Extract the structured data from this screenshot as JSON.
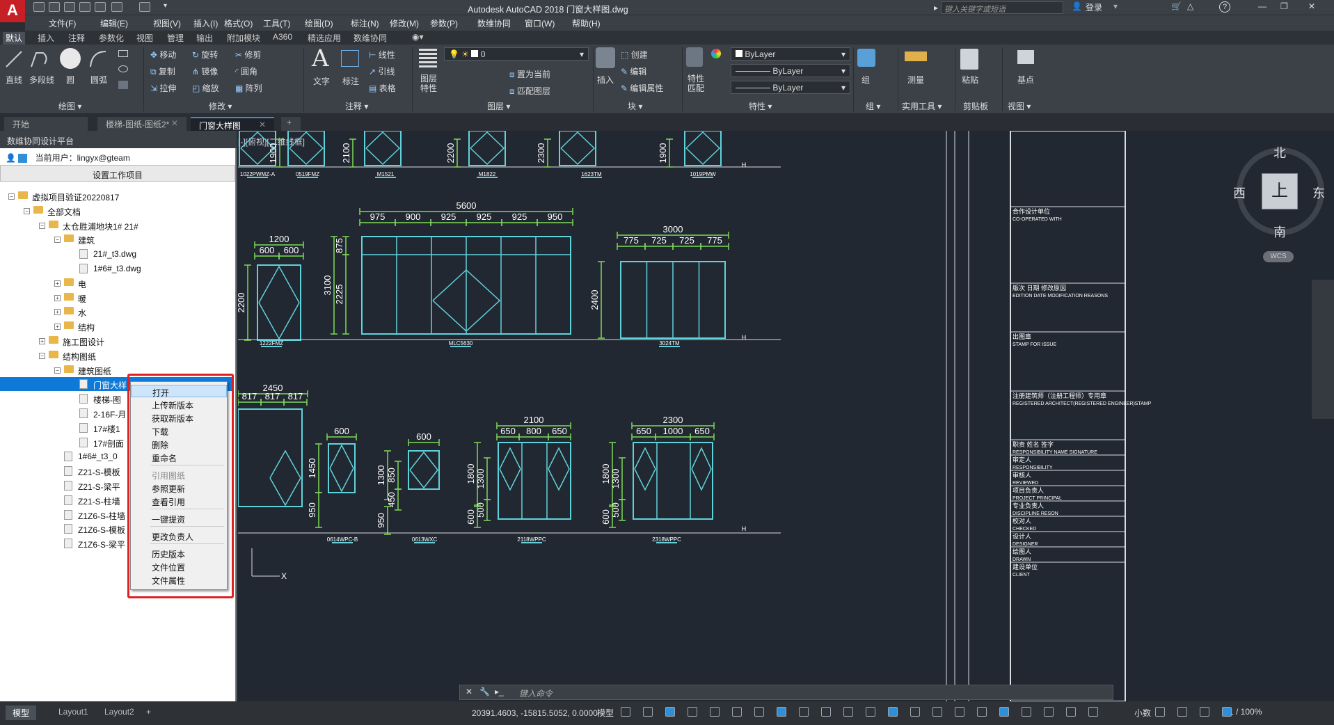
{
  "app": {
    "title": "Autodesk AutoCAD 2018    门窗大样图.dwg",
    "logo": "A",
    "search_placeholder": "键入关键字或短语",
    "login": "登录"
  },
  "menu": [
    "文件(F)",
    "编辑(E)",
    "视图(V)",
    "插入(I)",
    "格式(O)",
    "工具(T)",
    "绘图(D)",
    "标注(N)",
    "修改(M)",
    "参数(P)",
    "数维协同",
    "窗口(W)",
    "帮助(H)"
  ],
  "ribbon_tabs": [
    "默认",
    "插入",
    "注释",
    "参数化",
    "视图",
    "管理",
    "输出",
    "附加模块",
    "A360",
    "精选应用",
    "数维协同"
  ],
  "ribbon": {
    "draw": {
      "line": "直线",
      "polyline": "多段线",
      "circle": "圆",
      "arc": "圆弧",
      "label": "绘图 ▾"
    },
    "modify": {
      "move": "移动",
      "rotate": "旋转",
      "trim": "修剪",
      "copy": "复制",
      "mirror": "镜像",
      "fillet": "圆角",
      "stretch": "拉伸",
      "scale": "缩放",
      "array": "阵列",
      "label": "修改 ▾"
    },
    "annotation": {
      "text": "文字",
      "dim": "标注",
      "linear": "线性",
      "leader": "引线",
      "table": "表格",
      "label": "注释 ▾"
    },
    "layers": {
      "props": "图层\n特性",
      "current_layer": "0",
      "set_current": "置为当前",
      "match_layer": "匹配图层",
      "label": "图层 ▾"
    },
    "block": {
      "insert": "插入",
      "create": "创建",
      "edit": "编辑",
      "edit_attr": "编辑属性",
      "label": "块 ▾"
    },
    "properties": {
      "match": "特性\n匹配",
      "color": "ByLayer",
      "linetype": "ByLayer",
      "lineweight": "ByLayer",
      "label": "特性 ▾"
    },
    "groups": {
      "group": "组",
      "label": "组 ▾"
    },
    "utilities": {
      "measure": "测量",
      "label": "实用工具 ▾"
    },
    "clipboard": {
      "paste": "粘贴",
      "label": "剪贴板"
    },
    "view": {
      "base": "基点",
      "label": "视图 ▾"
    }
  },
  "doc_tabs": [
    "开始",
    "楼梯-图纸-图纸2*",
    "门窗大样图"
  ],
  "panel": {
    "header": "数维协同设计平台",
    "current_user_label": "当前用户：lingyx@gteam",
    "set_project": "设置工作项目",
    "tree": [
      {
        "label": "虚拟项目验证20220817",
        "level": 0,
        "exp": "−",
        "kind": "folder"
      },
      {
        "label": "全部文档",
        "level": 1,
        "exp": "−",
        "kind": "folder"
      },
      {
        "label": "太仓胜浦地块1# 21#",
        "level": 2,
        "exp": "−",
        "kind": "folder"
      },
      {
        "label": "建筑",
        "level": 3,
        "exp": "−",
        "kind": "folder"
      },
      {
        "label": "21#_t3.dwg",
        "level": 4,
        "exp": "",
        "kind": "file"
      },
      {
        "label": "1#6#_t3.dwg",
        "level": 4,
        "exp": "",
        "kind": "file"
      },
      {
        "label": "电",
        "level": 3,
        "exp": "+",
        "kind": "folder"
      },
      {
        "label": "暖",
        "level": 3,
        "exp": "+",
        "kind": "folder"
      },
      {
        "label": "水",
        "level": 3,
        "exp": "+",
        "kind": "folder"
      },
      {
        "label": "结构",
        "level": 3,
        "exp": "+",
        "kind": "folder"
      },
      {
        "label": "施工图设计",
        "level": 2,
        "exp": "+",
        "kind": "folder"
      },
      {
        "label": "结构图纸",
        "level": 2,
        "exp": "−",
        "kind": "folder"
      },
      {
        "label": "建筑图纸",
        "level": 3,
        "exp": "−",
        "kind": "folder"
      },
      {
        "label": "门窗大样",
        "level": 4,
        "exp": "",
        "kind": "file",
        "selected": true
      },
      {
        "label": "楼梯-图",
        "level": 4,
        "exp": "",
        "kind": "file"
      },
      {
        "label": "2-16F-月",
        "level": 4,
        "exp": "",
        "kind": "file"
      },
      {
        "label": "17#楼1",
        "level": 4,
        "exp": "",
        "kind": "file"
      },
      {
        "label": "17#剖面",
        "level": 4,
        "exp": "",
        "kind": "file"
      },
      {
        "label": "1#6#_t3_0",
        "level": 3,
        "exp": "",
        "kind": "file"
      },
      {
        "label": "Z21-S-模板",
        "level": 3,
        "exp": "",
        "kind": "file"
      },
      {
        "label": "Z21-S-梁平",
        "level": 3,
        "exp": "",
        "kind": "file"
      },
      {
        "label": "Z21-S-柱墙",
        "level": 3,
        "exp": "",
        "kind": "file"
      },
      {
        "label": "Z1Z6-S-柱墙",
        "level": 3,
        "exp": "",
        "kind": "file"
      },
      {
        "label": "Z1Z6-S-模板",
        "level": 3,
        "exp": "",
        "kind": "file"
      },
      {
        "label": "Z1Z6-S-梁平",
        "level": 3,
        "exp": "",
        "kind": "file"
      }
    ]
  },
  "context_menu": [
    {
      "label": "打开",
      "state": "highlight"
    },
    {
      "label": "上传新版本",
      "state": "normal"
    },
    {
      "label": "获取新版本",
      "state": "normal"
    },
    {
      "label": "下载",
      "state": "normal"
    },
    {
      "label": "删除",
      "state": "normal"
    },
    {
      "label": "重命名",
      "state": "normal",
      "sep_after": true
    },
    {
      "label": "引用图纸",
      "state": "disabled"
    },
    {
      "label": "参照更新",
      "state": "normal"
    },
    {
      "label": "查看引用",
      "state": "normal",
      "sep_after": true
    },
    {
      "label": "一键提资",
      "state": "normal",
      "sep_after": true
    },
    {
      "label": "更改负责人",
      "state": "normal",
      "sep_after": true
    },
    {
      "label": "历史版本",
      "state": "normal"
    },
    {
      "label": "文件位置",
      "state": "normal"
    },
    {
      "label": "文件属性",
      "state": "normal"
    }
  ],
  "canvas": {
    "view_label": "[-][俯视][二维线框]",
    "compass": {
      "n": "北",
      "s": "南",
      "e": "东",
      "w": "西",
      "top": "上",
      "wcs": "WCS"
    },
    "top_row_dims": [
      "1900",
      "2100",
      "2200",
      "2300",
      "1900"
    ],
    "top_row_tags": [
      "1022PWMZ-A",
      "0519FMZ",
      "M1521",
      "M1822",
      "1623TM",
      "1019PMW"
    ],
    "w1": {
      "width": "1200",
      "parts": [
        "600",
        "600"
      ],
      "height": "2200",
      "tag": "1222FMZ"
    },
    "w2": {
      "width": "5600",
      "parts": [
        "975",
        "900",
        "925",
        "925",
        "925",
        "950"
      ],
      "heights": [
        "875",
        "3100",
        "2225"
      ],
      "tag": "MLC5630"
    },
    "w3": {
      "width": "3000",
      "parts": [
        "775",
        "725",
        "725",
        "775"
      ],
      "height": "2400",
      "tag": "3024TM"
    },
    "w4": {
      "width": "2450",
      "parts": [
        "817",
        "817",
        "817"
      ]
    },
    "w5": {
      "width": "600",
      "heights": [
        "1450",
        "950"
      ],
      "tag": "0614WPC-B"
    },
    "w6": {
      "width": "600",
      "heights": [
        "850",
        "1300",
        "450",
        "950"
      ],
      "tag": "0613WXC"
    },
    "w7": {
      "width": "2100",
      "parts": [
        "650",
        "800",
        "650"
      ],
      "heights": [
        "1800",
        "1300",
        "500",
        "600"
      ],
      "tag": "2118WPPC"
    },
    "w8": {
      "width": "2300",
      "parts": [
        "650",
        "1000",
        "650"
      ],
      "heights": [
        "1800",
        "1300",
        "500",
        "600"
      ],
      "tag": "2318WPPC"
    },
    "titleblock": [
      {
        "cn": "合作设计单位",
        "en": "CO-OPERATED WITH"
      },
      {
        "cn": "版次  日期  修改原因",
        "en": "EDITION  DATE  MODIFICATION REASONS"
      },
      {
        "cn": "出图章",
        "en": "STAMP FOR ISSUE"
      },
      {
        "cn": "注册建筑师（注册工程师）专用章",
        "en": "REGISTERED ARCHITECT(REGISTERED ENGINEER)STAMP"
      },
      {
        "cn": "职责  姓名  签字",
        "en": "RESPONSIBILITY  NAME  SIGNATURE"
      },
      {
        "cn": "审定人",
        "en": "RESPONSIBILITY"
      },
      {
        "cn": "审核人",
        "en": "REVIEWED"
      },
      {
        "cn": "项目负责人",
        "en": "PROJECT PRINCIPAL"
      },
      {
        "cn": "专业负责人",
        "en": "DISCIPLINE RESON"
      },
      {
        "cn": "校对人",
        "en": "CHECKED"
      },
      {
        "cn": "设计人",
        "en": "DESIGNER"
      },
      {
        "cn": "绘图人",
        "en": "DRAWN"
      },
      {
        "cn": "建设单位",
        "en": "CLIENT"
      }
    ]
  },
  "command": {
    "placeholder": "键入命令"
  },
  "status": {
    "layout_tabs": [
      "模型",
      "Layout1",
      "Layout2"
    ],
    "coords": "20391.4603, -15815.5052, 0.0000",
    "model": "模型",
    "scale": "1:1 / 100%",
    "units": "小数"
  },
  "colors": {
    "accent": "#2f90d8",
    "drawing": "#5fd3dc",
    "dims": "#7ed957",
    "frame": "#e02020"
  }
}
